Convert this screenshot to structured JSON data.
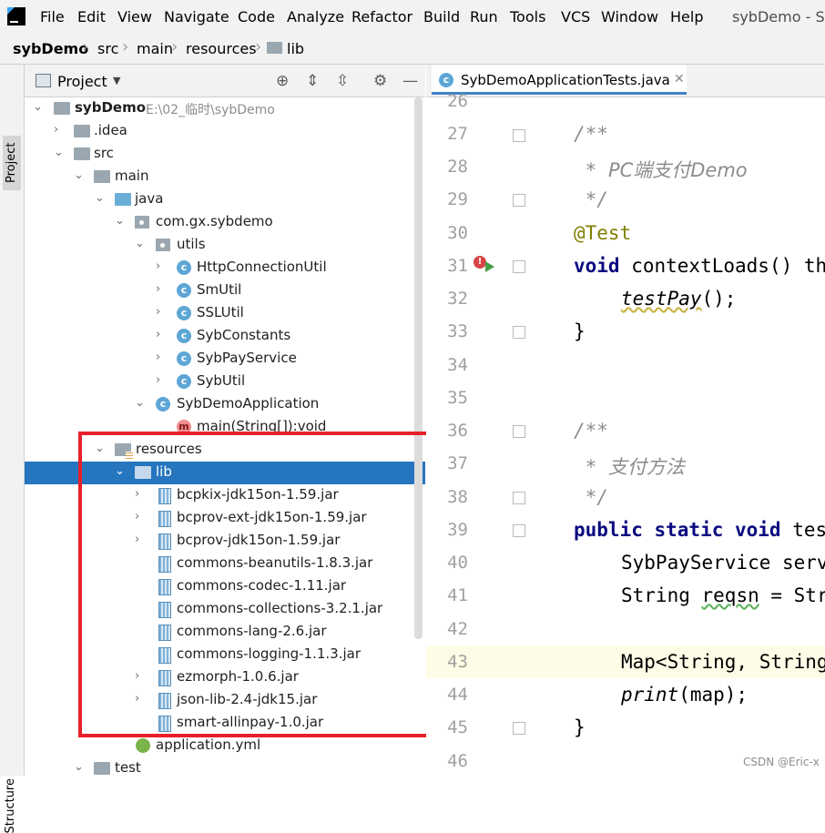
{
  "menubar": {
    "items": [
      {
        "label": "File",
        "mnemonic": "F"
      },
      {
        "label": "Edit",
        "mnemonic": "E"
      },
      {
        "label": "View",
        "mnemonic": "V"
      },
      {
        "label": "Navigate",
        "mnemonic": "N"
      },
      {
        "label": "Code",
        "mnemonic": "C"
      },
      {
        "label": "Analyze"
      },
      {
        "label": "Refactor",
        "mnemonic": "R"
      },
      {
        "label": "Build",
        "mnemonic": "B"
      },
      {
        "label": "Run",
        "mnemonic": "u"
      },
      {
        "label": "Tools",
        "mnemonic": "T"
      },
      {
        "label": "VCS",
        "mnemonic": "S"
      },
      {
        "label": "Window",
        "mnemonic": "W"
      },
      {
        "label": "Help",
        "mnemonic": "H"
      }
    ],
    "title": "sybDemo - Sy"
  },
  "breadcrumb": [
    "sybDemo",
    "src",
    "main",
    "resources",
    "lib"
  ],
  "side_tabs": {
    "project": "Project",
    "structure": "Structure"
  },
  "project_panel": {
    "title": "Project",
    "tree": [
      {
        "label": "sybDemo",
        "path": "E:\\02_临时\\sybDemo",
        "kind": "module",
        "expanded": true
      },
      {
        "label": ".idea",
        "kind": "folder",
        "expanded": false
      },
      {
        "label": "src",
        "kind": "folder",
        "expanded": true
      },
      {
        "label": "main",
        "kind": "folder",
        "expanded": true
      },
      {
        "label": "java",
        "kind": "source-folder",
        "expanded": true
      },
      {
        "label": "com.gx.sybdemo",
        "kind": "package",
        "expanded": true
      },
      {
        "label": "utils",
        "kind": "package",
        "expanded": true
      },
      {
        "label": "HttpConnectionUtil",
        "kind": "class",
        "expanded": false
      },
      {
        "label": "SmUtil",
        "kind": "class",
        "expanded": false
      },
      {
        "label": "SSLUtil",
        "kind": "class",
        "expanded": false
      },
      {
        "label": "SybConstants",
        "kind": "class",
        "expanded": false
      },
      {
        "label": "SybPayService",
        "kind": "class",
        "expanded": false
      },
      {
        "label": "SybUtil",
        "kind": "class",
        "expanded": false
      },
      {
        "label": "SybDemoApplication",
        "kind": "class",
        "expanded": true
      },
      {
        "label": "main(String[]):void",
        "kind": "method"
      },
      {
        "label": "resources",
        "kind": "resources-folder",
        "expanded": true
      },
      {
        "label": "lib",
        "kind": "folder",
        "expanded": true,
        "selected": true
      },
      {
        "label": "bcpkix-jdk15on-1.59.jar",
        "kind": "jar",
        "expandable": true
      },
      {
        "label": "bcprov-ext-jdk15on-1.59.jar",
        "kind": "jar",
        "expandable": true
      },
      {
        "label": "bcprov-jdk15on-1.59.jar",
        "kind": "jar",
        "expandable": true
      },
      {
        "label": "commons-beanutils-1.8.3.jar",
        "kind": "jar",
        "expandable": false
      },
      {
        "label": "commons-codec-1.11.jar",
        "kind": "jar",
        "expandable": false
      },
      {
        "label": "commons-collections-3.2.1.jar",
        "kind": "jar",
        "expandable": false
      },
      {
        "label": "commons-lang-2.6.jar",
        "kind": "jar",
        "expandable": false
      },
      {
        "label": "commons-logging-1.1.3.jar",
        "kind": "jar",
        "expandable": false
      },
      {
        "label": "ezmorph-1.0.6.jar",
        "kind": "jar",
        "expandable": true
      },
      {
        "label": "json-lib-2.4-jdk15.jar",
        "kind": "jar",
        "expandable": true
      },
      {
        "label": "smart-allinpay-1.0.jar",
        "kind": "jar",
        "expandable": false
      },
      {
        "label": "application.yml",
        "kind": "yml"
      },
      {
        "label": "test",
        "kind": "folder",
        "expanded": true
      }
    ]
  },
  "editor": {
    "tab": "SybDemoApplicationTests.java",
    "line_numbers": [
      "26",
      "27",
      "28",
      "29",
      "30",
      "31",
      "32",
      "33",
      "34",
      "35",
      "36",
      "37",
      "38",
      "39",
      "40",
      "41",
      "42",
      "43",
      "44",
      "45",
      "46"
    ],
    "code": {
      "l27": "/**",
      "l28_star": " * ",
      "l28_text": "PC端支付Demo",
      "l29": " */",
      "l30": "@Test",
      "l31_kw": "void",
      "l31_rest": " contextLoads() th",
      "l32_call": "testPay",
      "l32_rest": "();",
      "l33": "}",
      "l36": "/**",
      "l37_star": " * ",
      "l37_text": "支付方法",
      "l38": " */",
      "l39_kw": "public static void",
      "l39_rest": " tes",
      "l40": "SybPayService serv",
      "l41_a": "String ",
      "l41_b": "reqsn",
      "l41_c": " = Str",
      "l43": "Map<String, String",
      "l44_call": "print",
      "l44_rest": "(map);",
      "l45": "}"
    },
    "current_line": "43"
  },
  "watermark": "CSDN @Eric-x",
  "colors": {
    "selection": "#2675bf",
    "highlight_box": "#e8202a",
    "current_line": "#fdfce6"
  }
}
